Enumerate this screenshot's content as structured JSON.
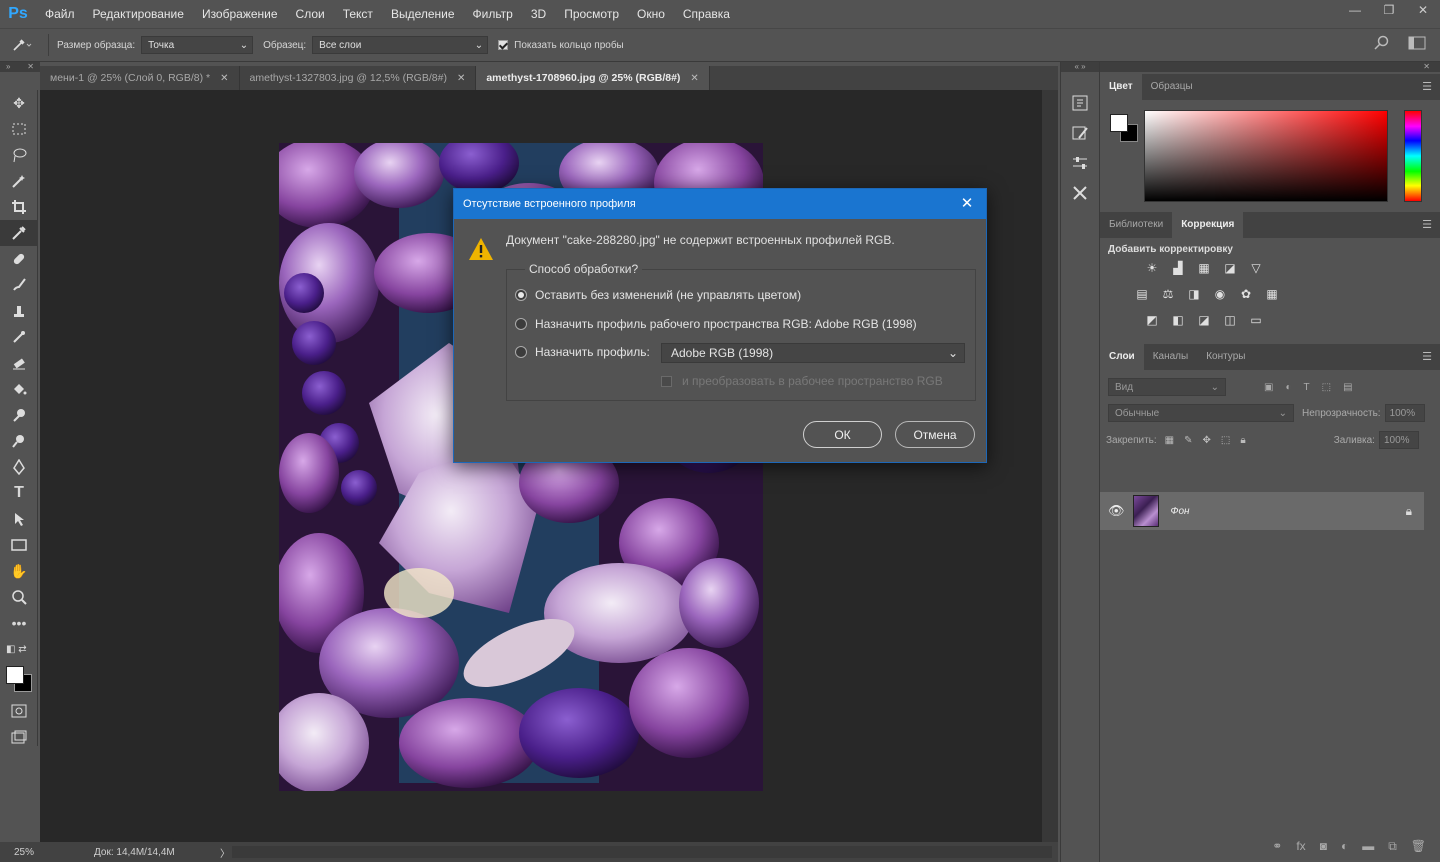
{
  "app": {
    "logo": "Ps"
  },
  "menu": [
    "Файл",
    "Редактирование",
    "Изображение",
    "Слои",
    "Текст",
    "Выделение",
    "Фильтр",
    "3D",
    "Просмотр",
    "Окно",
    "Справка"
  ],
  "window_controls": {
    "minimize": "—",
    "restore": "❐",
    "close": "✕"
  },
  "options": {
    "sample_size_label": "Размер образца:",
    "sample_size_value": "Точка",
    "sample_label": "Образец:",
    "sample_value": "Все слои",
    "show_ring_label": "Показать кольцо пробы",
    "show_ring_checked": true
  },
  "tabs": [
    {
      "label": "мени-1 @ 25% (Слой 0, RGB/8) *",
      "active": false
    },
    {
      "label": "amethyst-1327803.jpg @ 12,5% (RGB/8#)",
      "active": false
    },
    {
      "label": "amethyst-1708960.jpg @ 25% (RGB/8#)",
      "active": true
    }
  ],
  "status": {
    "zoom": "25%",
    "doc": "Док: 14,4M/14,4M",
    "arrow": "〉"
  },
  "color_panel": {
    "tabs": [
      "Цвет",
      "Образцы"
    ],
    "fg": "#ffffff",
    "bg": "#000000"
  },
  "adjust_panel": {
    "tabs": [
      "Библиотеки",
      "Коррекция"
    ],
    "title": "Добавить корректировку"
  },
  "layers_panel": {
    "tabs": [
      "Слои",
      "Каналы",
      "Контуры"
    ],
    "filter_placeholder": "Вид",
    "blend_mode": "Обычные",
    "opacity_label": "Непрозрачность:",
    "opacity_value": "100%",
    "lock_label": "Закрепить:",
    "fill_label": "Заливка:",
    "fill_value": "100%",
    "layer_name": "Фон"
  },
  "dialog": {
    "title": "Отсутствие встроенного профиля",
    "message": "Документ \"cake-288280.jpg\" не содержит встроенных профилей RGB.",
    "group_label": "Способ обработки?",
    "option1": "Оставить без изменений (не управлять цветом)",
    "option2": "Назначить профиль рабочего пространства RGB:  Adobe RGB (1998)",
    "option3": "Назначить профиль:",
    "profile_value": "Adobe RGB (1998)",
    "convert_label": "и преобразовать в рабочее пространство RGB",
    "ok": "ОК",
    "cancel": "Отмена",
    "selected_option": 1
  },
  "colors": {
    "accent": "#1a75d0",
    "ps_blue": "#31a8ff",
    "canvas": "#282828",
    "ui": "#535353"
  }
}
